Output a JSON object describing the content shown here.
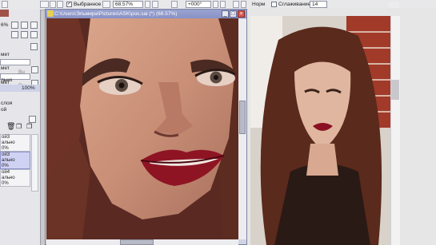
{
  "toolbar": {
    "selection_label": "Выбранное",
    "zoom_value": "68.57%",
    "rotation_value": "+000°",
    "blend_mode": "Норм",
    "smoothing_label": "Сглаживание",
    "smoothing_value": "14"
  },
  "canvas_window": {
    "title": "C:\\Users\\Эльмира\\Pictures\\ASK\\pos.sai (*) (68.57%)"
  },
  "left_panel": {
    "zoom_fragment": "6%",
    "field_label_1": "мет",
    "field_label_2": "мет",
    "field_label_3": "мет",
    "field_value_1": "Вн",
    "field_value_2": "Вн",
    "blend_fragment": "льно",
    "opacity_value": "100%",
    "layers_fragment": "слоя",
    "layers_fragment_2": "ой",
    "layers": [
      {
        "name": "ой3",
        "mode": "ально",
        "opacity": "0%"
      },
      {
        "name": "ой3",
        "mode": "ально",
        "opacity": "0%"
      },
      {
        "name": "ой4",
        "mode": "ально",
        "opacity": "0%"
      }
    ]
  },
  "colors": {
    "title_bar": "#8892c6",
    "panel": "#e6e6ea",
    "selected_layer": "#cfd2f2"
  }
}
